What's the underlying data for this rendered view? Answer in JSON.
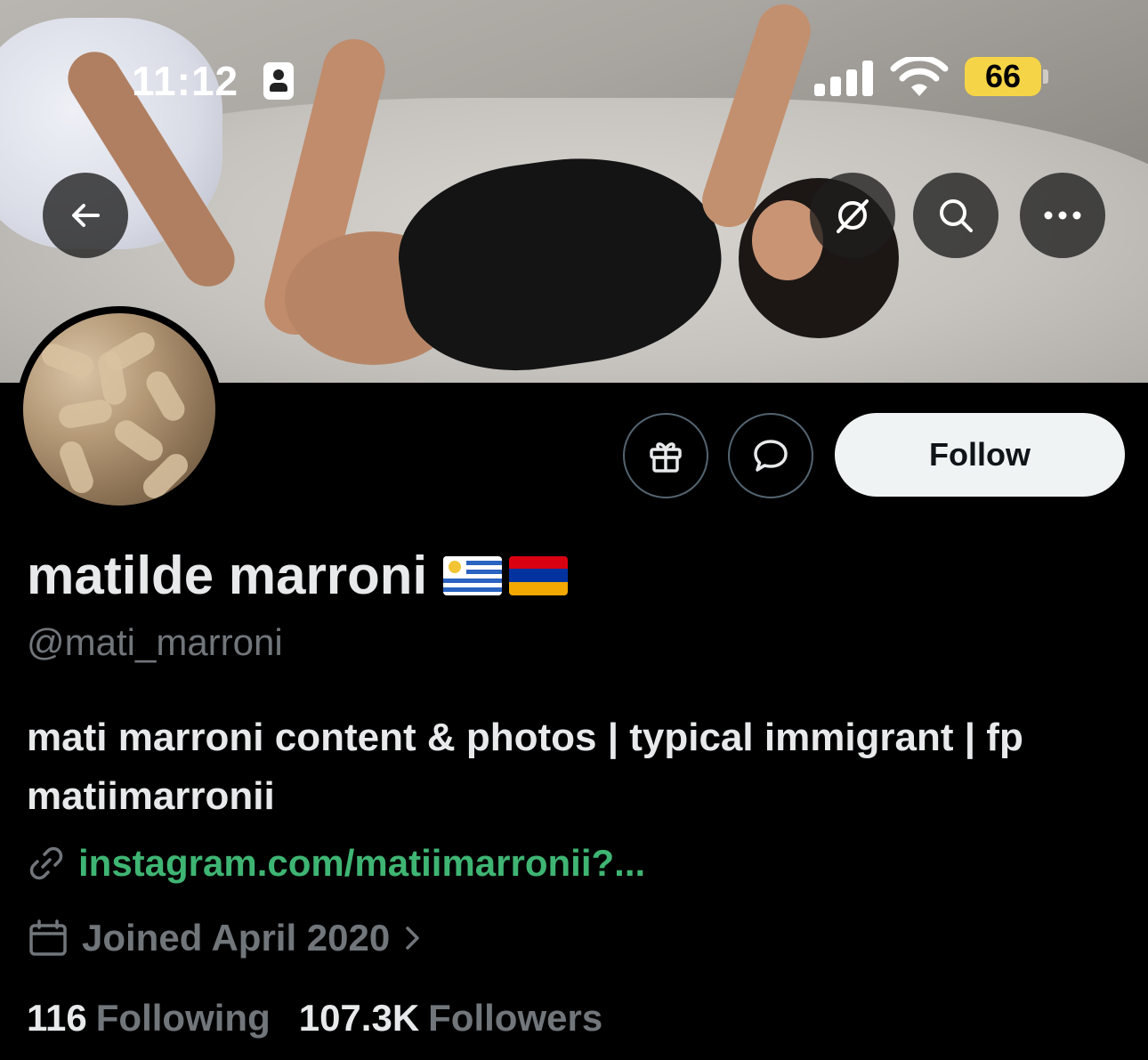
{
  "status_bar": {
    "time": "11:12",
    "battery": "66",
    "battery_color": "#f5d547"
  },
  "header": {
    "back_icon": "arrow-left-icon",
    "grok_icon": "slashed-circle-icon",
    "search_icon": "search-icon",
    "more_icon": "more-horizontal-icon"
  },
  "profile": {
    "display_name": "matilde marroni",
    "flags": [
      "uruguay-flag",
      "armenia-flag"
    ],
    "handle": "@mati_marroni",
    "bio": "mati marroni content & photos | typical immigrant | fp matiimarronii",
    "link": "instagram.com/matiimarronii?...",
    "joined": "Joined April 2020",
    "following_count": "116",
    "following_label": "Following",
    "followers_count": "107.3K",
    "followers_label": "Followers"
  },
  "actions": {
    "gift_icon": "gift-icon",
    "message_icon": "message-bubble-icon",
    "follow_label": "Follow"
  },
  "colors": {
    "link": "#3fb573",
    "secondary_text": "#71767b",
    "primary_text": "#e7e9ea",
    "follow_bg": "#eff3f4"
  }
}
